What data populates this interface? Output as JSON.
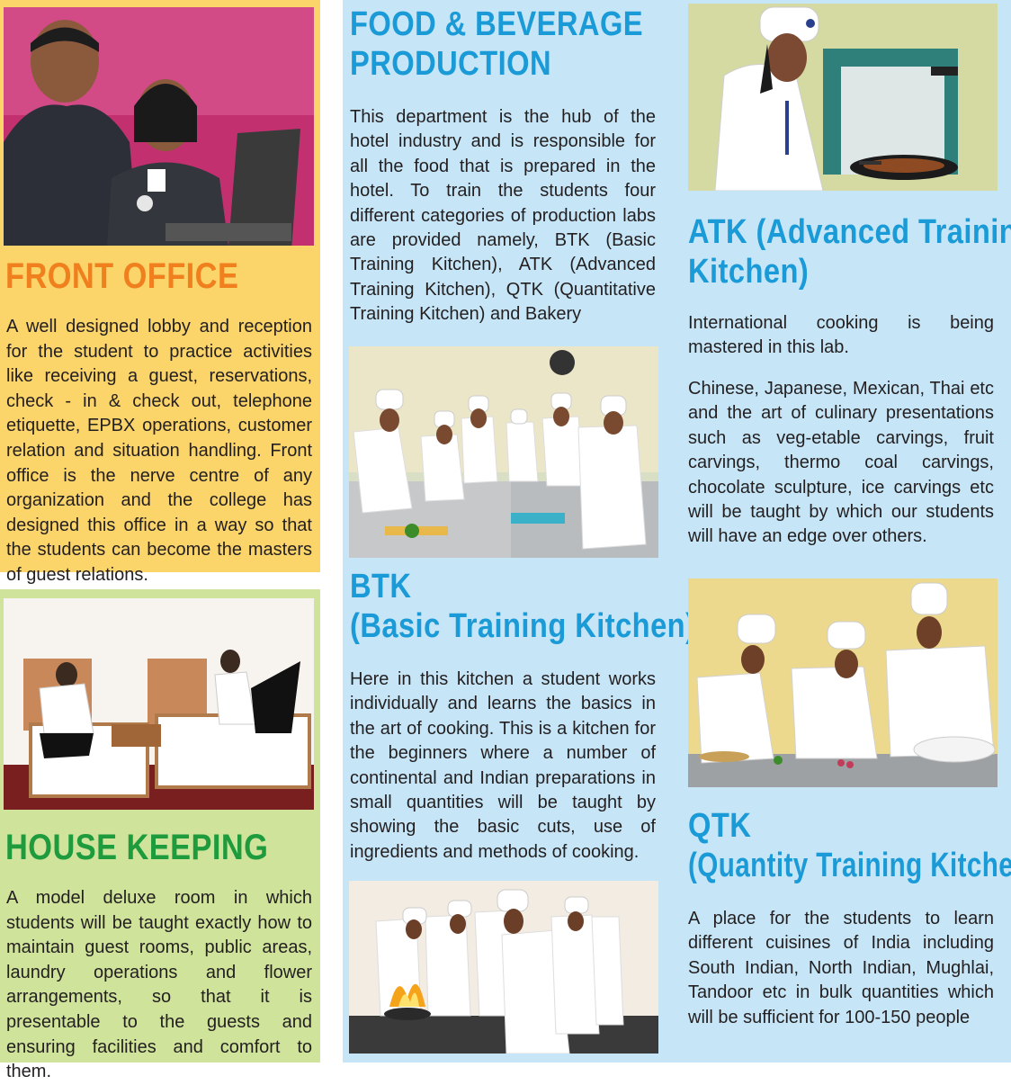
{
  "colors": {
    "front_office_bg": "#fbd46a",
    "house_keeping_bg": "#cfe39b",
    "kitchens_bg": "#c6e6f7",
    "front_office_heading": "#f07f1d",
    "house_keeping_heading": "#1e9b3c",
    "kitchens_heading": "#1a9ad6",
    "body_text": "#231f20"
  },
  "front_office": {
    "photo": "office-reception-photo",
    "heading": "FRONT OFFICE",
    "text": "A well designed lobby and reception for the student to practice activities like receiving a guest, reservations, check - in & check out, telephone etiquette, EPBX operations, customer relation and situation handling. Front office is the nerve centre of any organization and the college has designed this office in a way so that the students can become the masters of guest relations."
  },
  "house_keeping": {
    "photo": "hotel-room-photo",
    "heading": "HOUSE KEEPING",
    "text": "A model deluxe room in which students will be taught exactly how to maintain guest rooms, public areas, laundry operations and flower arrangements, so that it is presentable to the guests and ensuring facilities and comfort to them."
  },
  "food_beverage": {
    "heading_line1": "FOOD & BEVERAGE",
    "heading_line2": "PRODUCTION",
    "text": "This department is the hub of the hotel industry and is responsible for all the food that is prepared in the hotel. To train the students four different categories of production labs are provided namely, BTK (Basic Training Kitchen), ATK (Advanced Training Kitchen), QTK (Quantitative Training Kitchen) and Bakery"
  },
  "btk": {
    "photo": "kitchen-group-photo",
    "photo2": "cooking-flame-photo",
    "heading_line1": "BTK",
    "heading_line2": "(Basic Training Kitchen)",
    "text": "Here in this kitchen a student works individually and learns the  basics in the art of cooking. This is a kitchen for the beginners where a number of continental and Indian preparations in small quantities will be taught by showing the basic cuts, use of ingredients and methods of cooking."
  },
  "atk": {
    "photo": "chef-frying-photo",
    "heading_line1": "ATK (Advanced Training",
    "heading_line2": "Kitchen)",
    "text1": "International cooking is being mastered in this lab.",
    "text2": "Chinese, Japanese, Mexican, Thai etc and the art of culinary presentations such as veg-etable carvings, fruit carvings, thermo coal carvings, chocolate sculpture, ice carvings etc will be taught by which our students will have an edge over others."
  },
  "qtk": {
    "photo": "chefs-chopping-photo",
    "heading_line1": "QTK",
    "heading_line2": "(Quantity Training Kitchen)",
    "text": "A place for the students to learn different cuisines of India including South Indian, North Indian, Mughlai, Tandoor etc in bulk quantities which will be sufficient for 100-150 people"
  }
}
